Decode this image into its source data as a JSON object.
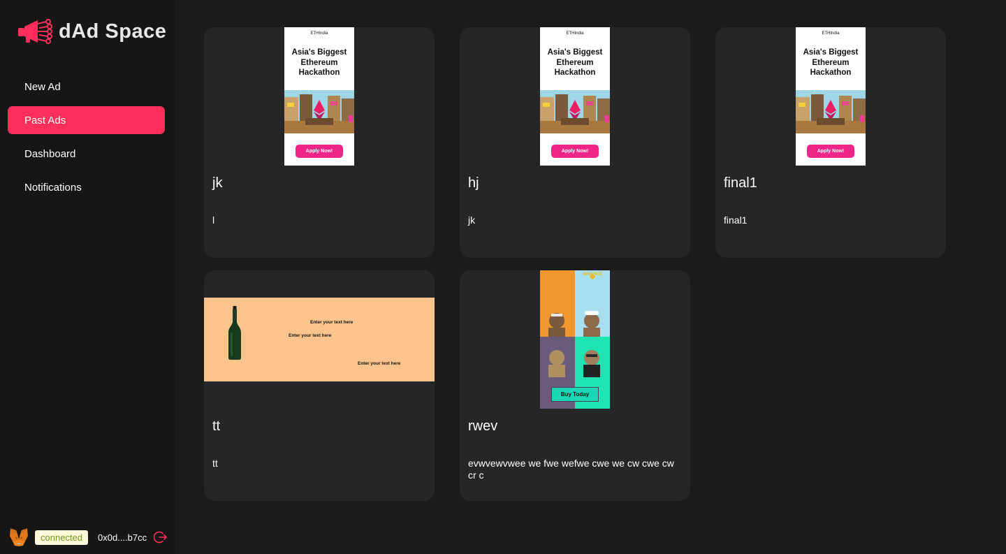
{
  "brand": {
    "name": "dAd Space",
    "accent": "#ff2f5b"
  },
  "nav": [
    {
      "label": "New Ad",
      "active": false
    },
    {
      "label": "Past Ads",
      "active": true
    },
    {
      "label": "Dashboard",
      "active": false
    },
    {
      "label": "Notifications",
      "active": false
    }
  ],
  "wallet": {
    "status": "connected",
    "address": "0x0d....b7cc",
    "icon": "metamask-fox-icon",
    "logout_icon": "logout-icon"
  },
  "ads": [
    {
      "title": "jk",
      "description": "l",
      "creative": {
        "kind": "ethindia",
        "logo": "ETHIndia",
        "headline": "Asia's Biggest Ethereum Hackathon",
        "button": "Apply Now!"
      }
    },
    {
      "title": "hj",
      "description": "jk",
      "creative": {
        "kind": "ethindia",
        "logo": "ETHIndia",
        "headline": "Asia's Biggest Ethereum Hackathon",
        "button": "Apply Now!"
      }
    },
    {
      "title": "final1",
      "description": "final1",
      "creative": {
        "kind": "ethindia",
        "logo": "ETHIndia",
        "headline": "Asia's Biggest Ethereum Hackathon",
        "button": "Apply Now!"
      }
    },
    {
      "title": "tt",
      "description": "tt",
      "creative": {
        "kind": "wine",
        "texts": [
          "Enter your text here",
          "Enter your text here",
          "Enter your text here"
        ]
      }
    },
    {
      "title": "rwev",
      "description": "evwvewvwee we fwe wefwe cwe we cw cwe cw cr c",
      "creative": {
        "kind": "binance",
        "brand": "BINANCE",
        "button": "Buy Today"
      }
    }
  ]
}
